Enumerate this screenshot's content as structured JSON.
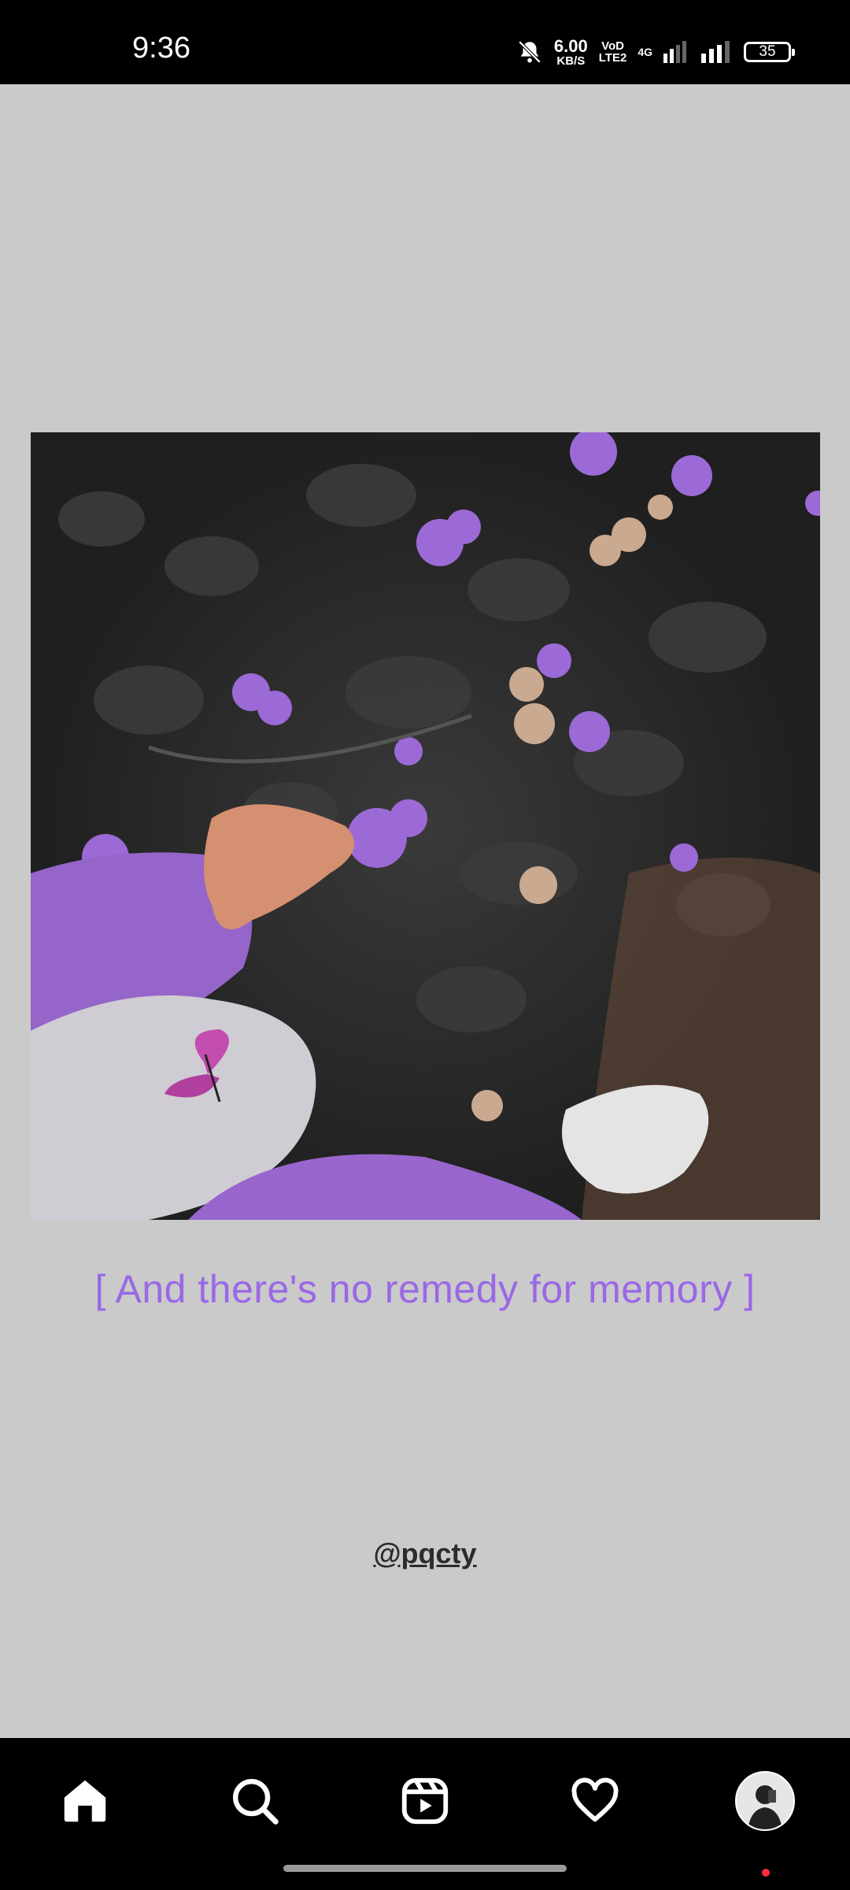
{
  "status_bar": {
    "time": "9:36",
    "net_speed_value": "6.00",
    "net_speed_unit": "KB/S",
    "volte_top": "VoD",
    "volte_bottom": "LTE2",
    "network_type": "4G",
    "battery_level": "35"
  },
  "post": {
    "caption": "[ And there's no remedy for memory ]",
    "handle": "@pqcty"
  },
  "bottom_nav": {
    "items": [
      {
        "name": "home",
        "icon": "home-icon",
        "active": true
      },
      {
        "name": "search",
        "icon": "search-icon"
      },
      {
        "name": "reels",
        "icon": "reels-icon"
      },
      {
        "name": "activity",
        "icon": "heart-icon"
      },
      {
        "name": "profile",
        "icon": "avatar",
        "has_notification": true
      }
    ]
  },
  "colors": {
    "background": "#cacaca",
    "caption": "#9a68e6",
    "notification": "#ff2d3d"
  }
}
